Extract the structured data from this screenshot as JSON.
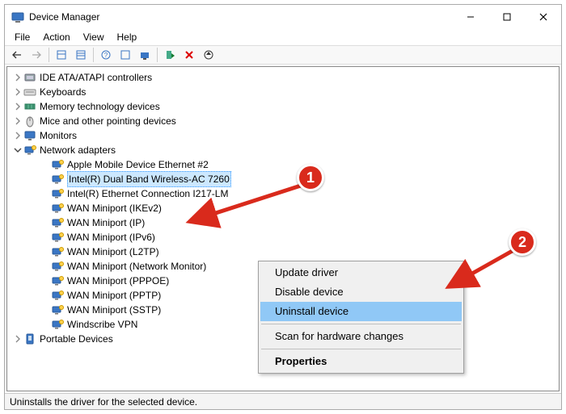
{
  "window": {
    "title": "Device Manager"
  },
  "menu": {
    "file": "File",
    "action": "Action",
    "view": "View",
    "help": "Help"
  },
  "status": {
    "text": "Uninstalls the driver for the selected device."
  },
  "categories": [
    {
      "label": "IDE ATA/ATAPI controllers",
      "icon": "ide"
    },
    {
      "label": "Keyboards",
      "icon": "keyboard"
    },
    {
      "label": "Memory technology devices",
      "icon": "memory"
    },
    {
      "label": "Mice and other pointing devices",
      "icon": "mouse"
    },
    {
      "label": "Monitors",
      "icon": "monitor"
    },
    {
      "label": "Network adapters",
      "icon": "network",
      "expanded": true
    },
    {
      "label": "Portable Devices",
      "icon": "portable"
    }
  ],
  "net_devices": [
    {
      "label": "Apple Mobile Device Ethernet #2"
    },
    {
      "label": "Intel(R) Dual Band Wireless-AC 7260",
      "selected": true
    },
    {
      "label": "Intel(R) Ethernet Connection I217-LM"
    },
    {
      "label": "WAN Miniport (IKEv2)"
    },
    {
      "label": "WAN Miniport (IP)"
    },
    {
      "label": "WAN Miniport (IPv6)"
    },
    {
      "label": "WAN Miniport (L2TP)"
    },
    {
      "label": "WAN Miniport (Network Monitor)"
    },
    {
      "label": "WAN Miniport (PPPOE)"
    },
    {
      "label": "WAN Miniport (PPTP)"
    },
    {
      "label": "WAN Miniport (SSTP)"
    },
    {
      "label": "Windscribe VPN"
    }
  ],
  "context": {
    "update": "Update driver",
    "disable": "Disable device",
    "uninstall": "Uninstall device",
    "scan": "Scan for hardware changes",
    "properties": "Properties"
  },
  "annotations": {
    "one": "1",
    "two": "2"
  }
}
